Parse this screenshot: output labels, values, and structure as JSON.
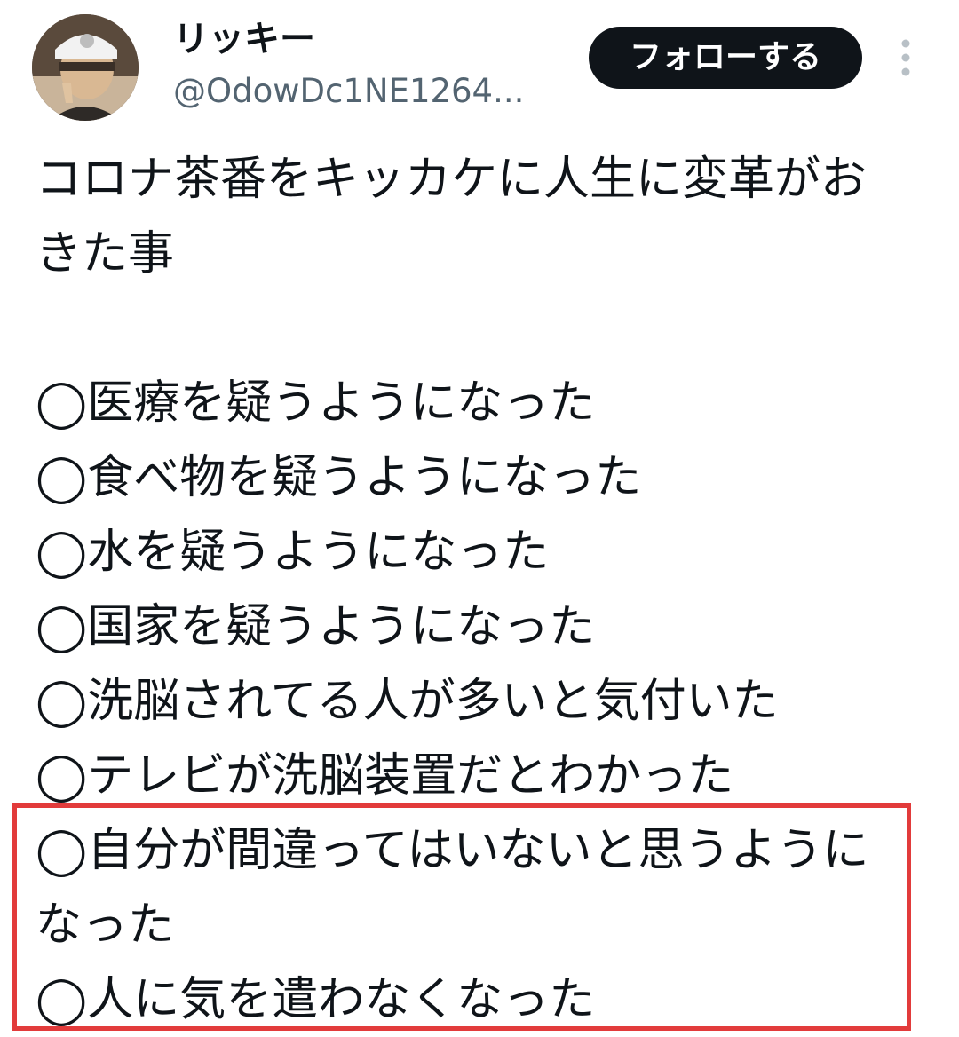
{
  "user": {
    "name": "リッキー",
    "handle": "@OdowDc1NE1264...",
    "avatar_icon": "user-avatar-photo"
  },
  "actions": {
    "follow_label": "フォローする",
    "more_icon": "more-vertical-icon"
  },
  "tweet": {
    "intro_lines": [
      "コロナ茶番をキッカケに人生に変革がお",
      "きた事"
    ],
    "items": [
      "◯医療を疑うようになった",
      "◯食べ物を疑うようになった",
      "◯水を疑うようになった",
      "◯国家を疑うようになった",
      "◯洗脳されてる人が多いと気付いた",
      "◯テレビが洗脳装置だとわかった"
    ],
    "highlighted_items": [
      "◯自分が間違ってはいないと思うように",
      "なった",
      "◯人に気を遣わなくなった"
    ]
  },
  "colors": {
    "text": "#0f1419",
    "secondary_text": "#536471",
    "follow_button_bg": "#0f1419",
    "highlight_border": "#e23b3b"
  }
}
